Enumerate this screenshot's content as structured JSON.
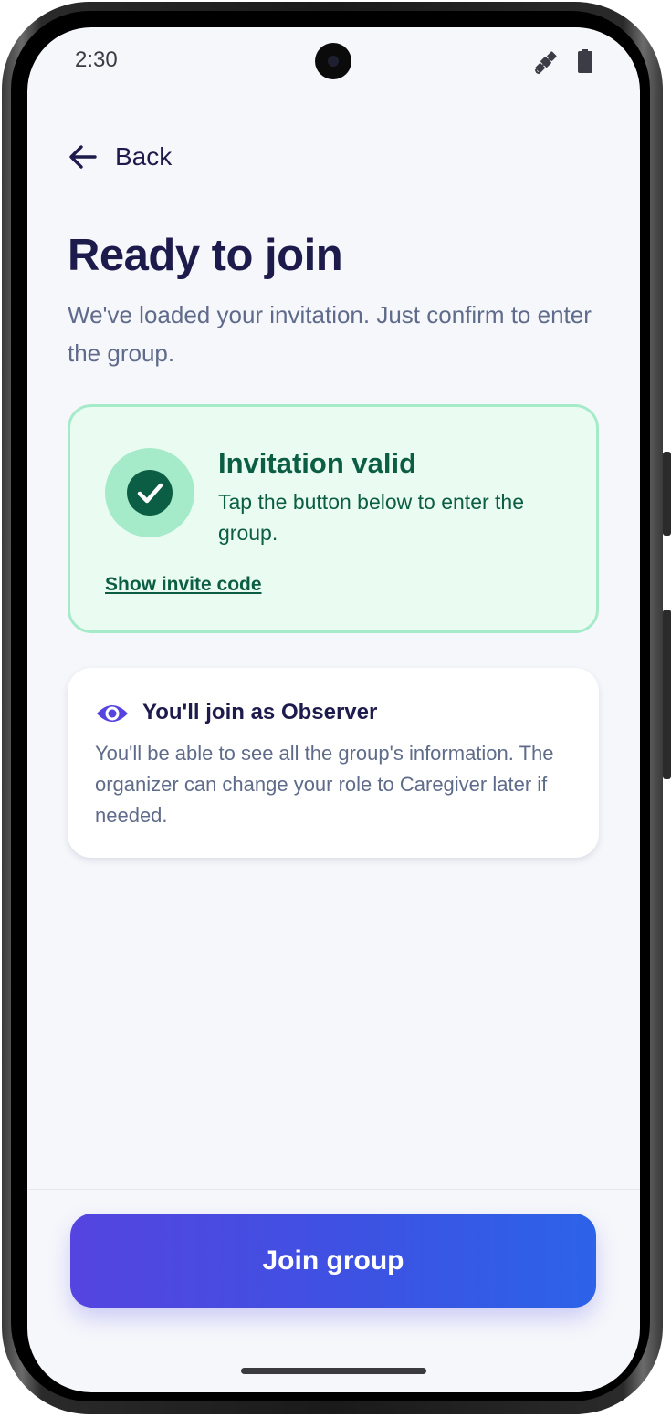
{
  "status_bar": {
    "time": "2:30",
    "icons": [
      "satellite-icon",
      "battery-icon"
    ]
  },
  "nav": {
    "back_label": "Back",
    "back_icon": "arrow-left-icon"
  },
  "header": {
    "title": "Ready to join",
    "subtitle": "We've loaded your invitation. Just confirm to enter the group."
  },
  "invitation_card": {
    "icon": "check-circle-icon",
    "title": "Invitation valid",
    "description": "Tap the button below to enter the group.",
    "show_code_link": "Show invite code",
    "colors": {
      "background": "#eafbf2",
      "border": "#a6ebc9",
      "text": "#0b5e43"
    }
  },
  "role_card": {
    "icon": "eye-icon",
    "title": "You'll join as Observer",
    "description": "You'll be able to see all the group's information. The organizer can change your role to Caregiver later if needed."
  },
  "primary_action": {
    "label": "Join group",
    "gradient": [
      "#5544e0",
      "#2c63e8"
    ]
  },
  "colors": {
    "heading": "#1d1b4b",
    "body": "#5f6b8a",
    "accent": "#5544e0"
  }
}
